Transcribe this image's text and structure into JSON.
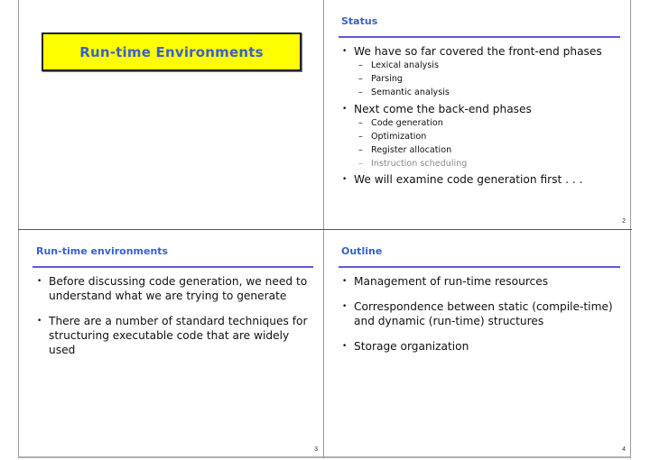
{
  "slides": [
    {
      "title": "Run-time Environments",
      "title_box_color": "#ffff00",
      "title_color": "#3a62c8"
    },
    {
      "heading": "Status",
      "page_number": "2",
      "bullets": [
        {
          "text": "We have so far covered the front-end phases",
          "sub": [
            "Lexical analysis",
            "Parsing",
            "Semantic analysis"
          ]
        },
        {
          "text": "Next come the back-end phases",
          "sub": [
            "Code generation",
            "Optimization",
            "Register allocation",
            "Instruction scheduling"
          ],
          "dimmed_sub": [
            "Instruction scheduling"
          ]
        },
        {
          "text": "We will examine code generation first . . .",
          "sub": []
        }
      ]
    },
    {
      "heading": "Run-time environments",
      "page_number": "3",
      "bullets": [
        {
          "text": "Before discussing code generation, we need to understand what we are trying to generate"
        },
        {
          "text": "There are a number of standard techniques for structuring executable code that are widely used"
        }
      ]
    },
    {
      "heading": "Outline",
      "page_number": "4",
      "bullets": [
        {
          "text": "Management of run-time resources"
        },
        {
          "text": "Correspondence between static (compile-time) and dynamic (run-time) structures"
        },
        {
          "text": "Storage organization"
        }
      ]
    }
  ],
  "colors": {
    "heading": "#3a5fcc",
    "rule": "#5a5ad8",
    "dimmed": "#8a8a8a"
  }
}
